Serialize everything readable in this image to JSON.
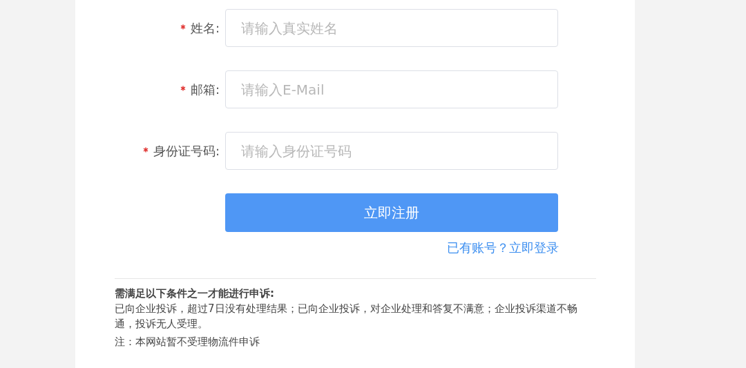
{
  "fields": [
    {
      "label": "姓名:",
      "required": true,
      "placeholder": "请输入真实姓名"
    },
    {
      "label": "邮箱:",
      "required": true,
      "placeholder": "请输入E-Mail"
    },
    {
      "label": "身份证号码:",
      "required": true,
      "placeholder": "请输入身份证号码"
    }
  ],
  "submit_button": "立即注册",
  "login_link": "已有账号？立即登录",
  "notice": {
    "title": "需满足以下条件之一才能进行申诉:",
    "body": "已向企业投诉，超过7日没有处理结果；已向企业投诉，对企业处理和答复不满意；企业投诉渠道不畅通，投诉无人受理。",
    "note": "注：本网站暂不受理物流件申诉"
  }
}
